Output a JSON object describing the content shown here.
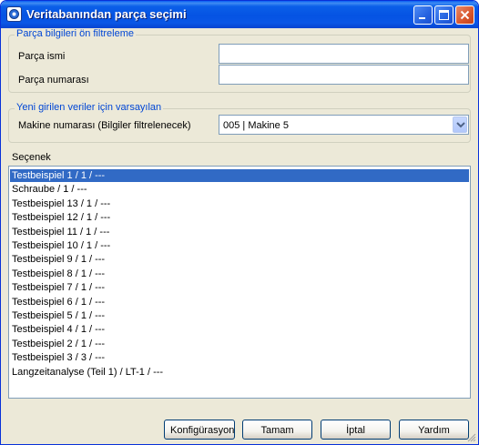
{
  "window": {
    "title": "Veritabanından parça seçimi",
    "controls": {
      "minimize": "minimize-icon",
      "maximize": "maximize-icon",
      "close": "close-icon"
    }
  },
  "filter_group": {
    "legend": "Parça bilgileri ön filtreleme",
    "part_name_label": "Parça ismi",
    "part_name_value": "",
    "part_number_label": "Parça numarası",
    "part_number_value": ""
  },
  "defaults_group": {
    "legend": "Yeni girilen veriler için varsayılan",
    "machine_label": "Makine numarası (Bilgiler filtrelenecek)",
    "machine_value": "005 | Makine 5"
  },
  "options": {
    "label": "Seçenek",
    "items": [
      "Testbeispiel 1 / 1 / ---",
      "Schraube / 1 / ---",
      "Testbeispiel 13 / 1 / ---",
      "Testbeispiel 12 / 1 / ---",
      "Testbeispiel 11 / 1 / ---",
      "Testbeispiel 10 / 1 / ---",
      "Testbeispiel 9 / 1 / ---",
      "Testbeispiel 8 / 1 / ---",
      "Testbeispiel 7 / 1 / ---",
      "Testbeispiel 6 / 1 / ---",
      "Testbeispiel 5 / 1 / ---",
      "Testbeispiel 4 / 1 / ---",
      "Testbeispiel 2 / 1 / ---",
      "Testbeispiel 3 / 3 / ---",
      "Langzeitanalyse (Teil 1) / LT-1 / ---"
    ],
    "selected_index": 0
  },
  "buttons": {
    "config": "Konfigürasyon",
    "ok": "Tamam",
    "cancel": "İptal",
    "help": "Yardım"
  },
  "colors": {
    "titlebar": "#0553e3",
    "selection": "#316ac5",
    "legend_text": "#0046d5",
    "dialog_bg": "#ece9d8"
  }
}
